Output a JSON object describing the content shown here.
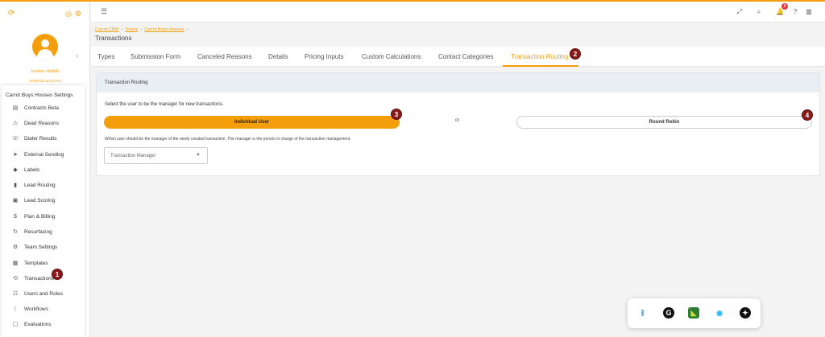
{
  "colors": {
    "accent": "#f59e0b",
    "badge": "#8b1a1a",
    "header_bg": "#e9eef5"
  },
  "sidebar": {
    "user_name": "treslee otailab",
    "user_email": "treslee@carrot.com",
    "settings_title": "Carrot Buys Houses Settings",
    "items": [
      {
        "label": "Contracts Beta",
        "icon": "clipboard-icon"
      },
      {
        "label": "Dead Reasons",
        "icon": "warning-icon"
      },
      {
        "label": "Dialer Results",
        "icon": "phone-icon"
      },
      {
        "label": "External Sending",
        "icon": "send-icon"
      },
      {
        "label": "Labels",
        "icon": "tag-icon"
      },
      {
        "label": "Lead Routing",
        "icon": "bar-chart-icon"
      },
      {
        "label": "Lead Scoring",
        "icon": "score-icon"
      },
      {
        "label": "Plan & Billing",
        "icon": "dollar-icon"
      },
      {
        "label": "Resurfacing",
        "icon": "refresh-icon"
      },
      {
        "label": "Team Settings",
        "icon": "team-gear-icon"
      },
      {
        "label": "Templates",
        "icon": "templates-icon"
      },
      {
        "label": "Transactions",
        "icon": "sync-icon"
      },
      {
        "label": "Users and Roles",
        "icon": "users-icon"
      },
      {
        "label": "Workflows",
        "icon": "workflow-icon"
      },
      {
        "label": "Evaluations",
        "icon": "document-icon"
      }
    ]
  },
  "topbar": {
    "notification_count": "8"
  },
  "breadcrumb": {
    "items": [
      "Carrot CRM",
      "Teams",
      "Carrot Buys Houses"
    ]
  },
  "page_title": "Transactions",
  "tabs": [
    {
      "label": "Types"
    },
    {
      "label": "Submission Form"
    },
    {
      "label": "Canceled Reasons"
    },
    {
      "label": "Details"
    },
    {
      "label": "Pricing Inputs"
    },
    {
      "label": "Custom Calculations"
    },
    {
      "label": "Contact Categories"
    },
    {
      "label": "Transaction Routing",
      "active": true
    }
  ],
  "card": {
    "title": "Transaction Routing",
    "instruction": "Select the user to be the manager for new transactions.",
    "option_individual": "Individual User",
    "or_text": "or",
    "option_round_robin": "Round Robin",
    "description": "Which user should be the manager of the newly created transaction. The manager is the person in charge of the transaction management.",
    "select_placeholder": "Transaction Manager"
  },
  "annotations": {
    "b1": "1",
    "b2": "2",
    "b3": "3",
    "b4": "4"
  },
  "dock": {
    "items": [
      "bluetooth-icon",
      "grammarly-icon",
      "nvidia-icon",
      "network-icon",
      "app-icon"
    ]
  }
}
